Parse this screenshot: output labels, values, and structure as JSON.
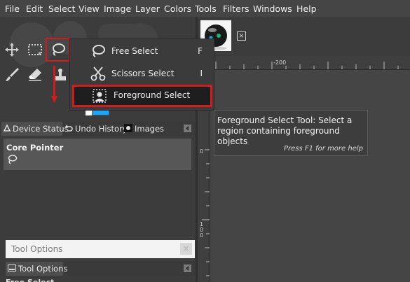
{
  "menubar": {
    "items": [
      "File",
      "Edit",
      "Select",
      "View",
      "Image",
      "Layer",
      "Colors",
      "Tools",
      "Filters",
      "Windows",
      "Help"
    ]
  },
  "dropdown": {
    "items": [
      {
        "label": "Free Select",
        "shortcut": "F",
        "icon": "lasso-icon"
      },
      {
        "label": "Scissors Select",
        "shortcut": "I",
        "icon": "scissors-icon"
      },
      {
        "label": "Foreground Select",
        "shortcut": "",
        "icon": "foreground-select-icon"
      }
    ]
  },
  "tooltip": {
    "text": "Foreground Select Tool: Select a region containing foreground objects",
    "help": "Press F1 for more help"
  },
  "dock_tabs": {
    "device_status": "Device Status",
    "undo_history": "Undo History",
    "images": "Images"
  },
  "device_status": {
    "core_pointer": "Core Pointer"
  },
  "tool_options": {
    "dock_title": "Tool Options",
    "tab_label": "Tool Options",
    "bottom_text": "Free Select"
  },
  "ruler": {
    "top_label": "-200",
    "left_label_1": "0",
    "left_label_2": "100"
  },
  "colors": {
    "highlight": "#d21b1b",
    "menubar_bg": "#454545",
    "panel_bg": "#3c3c3c"
  }
}
